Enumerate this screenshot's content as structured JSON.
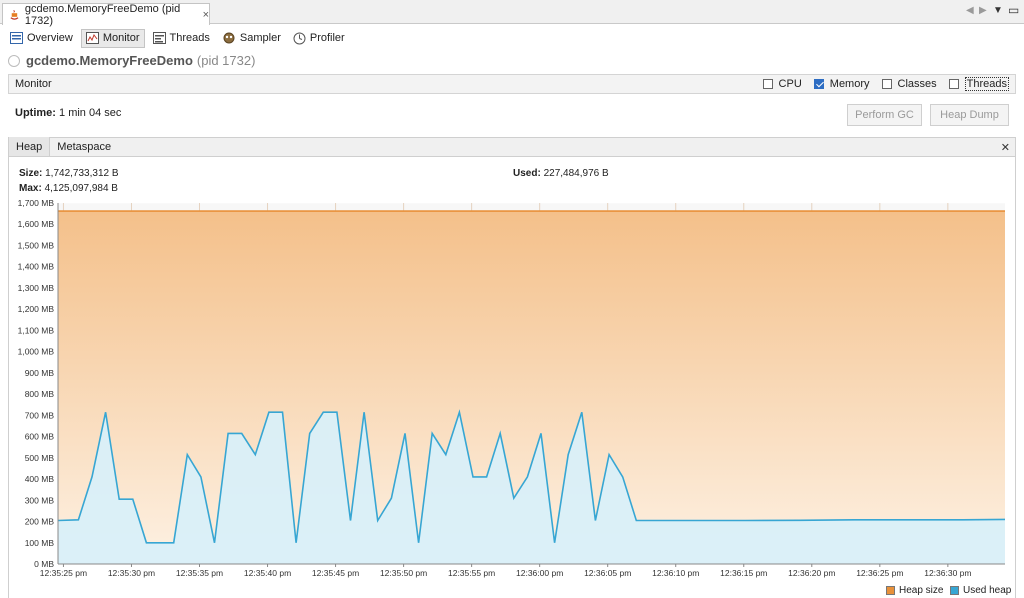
{
  "window": {
    "tab_title": "gcdemo.MemoryFreeDemo (pid 1732)",
    "close_glyph": "×"
  },
  "subtabs": [
    {
      "label": "Overview",
      "icon": "overview-icon"
    },
    {
      "label": "Monitor",
      "icon": "monitor-icon"
    },
    {
      "label": "Threads",
      "icon": "threads-icon"
    },
    {
      "label": "Sampler",
      "icon": "sampler-icon"
    },
    {
      "label": "Profiler",
      "icon": "profiler-icon"
    }
  ],
  "process": {
    "name": "gcdemo.MemoryFreeDemo",
    "pid": "(pid 1732)"
  },
  "monitor": {
    "title": "Monitor",
    "checkboxes": [
      {
        "label": "CPU",
        "checked": false
      },
      {
        "label": "Memory",
        "checked": true
      },
      {
        "label": "Classes",
        "checked": false
      },
      {
        "label": "Threads",
        "checked": false
      }
    ],
    "uptime_label": "Uptime:",
    "uptime_value": "1 min 04 sec",
    "perform_gc": "Perform GC",
    "heap_dump": "Heap Dump"
  },
  "heap": {
    "tabs": [
      "Heap",
      "Metaspace"
    ],
    "size_label": "Size:",
    "size_value": "1,742,733,312 B",
    "max_label": "Max:",
    "max_value": "4,125,097,984 B",
    "used_label": "Used:",
    "used_value": "227,484,976 B"
  },
  "colors": {
    "heap_size": "#e8913a",
    "used_heap": "#37a6d3",
    "heap_fill_top": "#f4c08a",
    "heap_fill_bottom": "#fdf1e3",
    "used_fill": "#d8f0fa"
  },
  "chart_data": {
    "type": "area",
    "ylim": [
      0,
      1700
    ],
    "y_ticks": [
      "0 MB",
      "100 MB",
      "200 MB",
      "300 MB",
      "400 MB",
      "500 MB",
      "600 MB",
      "700 MB",
      "800 MB",
      "900 MB",
      "1,000 MB",
      "1,100 MB",
      "1,200 MB",
      "1,300 MB",
      "1,400 MB",
      "1,500 MB",
      "1,600 MB",
      "1,700 MB"
    ],
    "x_ticks": [
      "12:35:25 pm",
      "12:35:30 pm",
      "12:35:35 pm",
      "12:35:40 pm",
      "12:35:45 pm",
      "12:35:50 pm",
      "12:35:55 pm",
      "12:36:00 pm",
      "12:36:05 pm",
      "12:36:10 pm",
      "12:36:15 pm",
      "12:36:20 pm",
      "12:36:25 pm",
      "12:36:30 pm"
    ],
    "x_start_seconds": -0.4,
    "x_end_seconds": 69.2,
    "series": [
      {
        "name": "Heap size",
        "points": [
          [
            -0.4,
            1662
          ],
          [
            69.2,
            1662
          ]
        ]
      },
      {
        "name": "Used heap",
        "points": [
          [
            -0.4,
            205
          ],
          [
            1.1,
            208
          ],
          [
            2.1,
            410
          ],
          [
            3.1,
            715
          ],
          [
            4.1,
            305
          ],
          [
            5.1,
            305
          ],
          [
            6.1,
            100
          ],
          [
            7.1,
            100
          ],
          [
            8.1,
            100
          ],
          [
            9.1,
            515
          ],
          [
            10.1,
            410
          ],
          [
            11.1,
            100
          ],
          [
            12.1,
            615
          ],
          [
            13.1,
            615
          ],
          [
            14.1,
            515
          ],
          [
            15.1,
            715
          ],
          [
            16.1,
            715
          ],
          [
            17.1,
            100
          ],
          [
            18.1,
            615
          ],
          [
            19.1,
            715
          ],
          [
            20.1,
            715
          ],
          [
            21.1,
            205
          ],
          [
            22.1,
            715
          ],
          [
            23.1,
            205
          ],
          [
            24.1,
            310
          ],
          [
            25.1,
            615
          ],
          [
            26.1,
            100
          ],
          [
            27.1,
            615
          ],
          [
            28.1,
            515
          ],
          [
            29.1,
            715
          ],
          [
            30.1,
            410
          ],
          [
            31.1,
            410
          ],
          [
            32.1,
            615
          ],
          [
            33.1,
            310
          ],
          [
            34.1,
            410
          ],
          [
            35.1,
            615
          ],
          [
            36.1,
            100
          ],
          [
            37.1,
            515
          ],
          [
            38.1,
            715
          ],
          [
            39.1,
            205
          ],
          [
            40.1,
            515
          ],
          [
            41.1,
            410
          ],
          [
            42.1,
            205
          ],
          [
            46.1,
            205
          ],
          [
            50.1,
            205
          ],
          [
            54.1,
            206
          ],
          [
            58.1,
            208
          ],
          [
            62.1,
            208
          ],
          [
            66.1,
            208
          ],
          [
            69.2,
            210
          ]
        ]
      }
    ],
    "legend": [
      {
        "label": "Heap size",
        "color": "#e8913a"
      },
      {
        "label": "Used heap",
        "color": "#37a6d3"
      }
    ]
  }
}
